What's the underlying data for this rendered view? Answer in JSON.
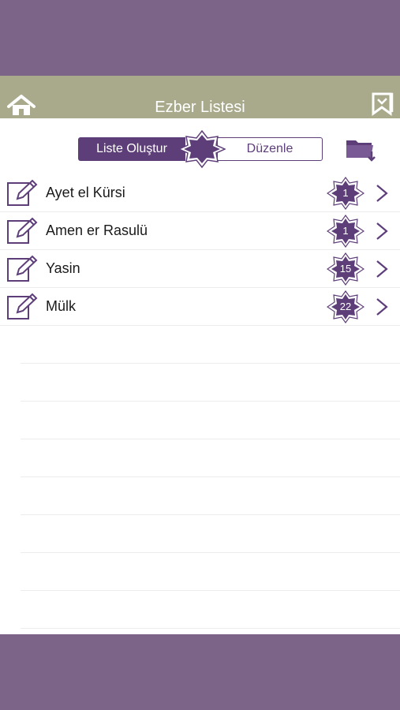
{
  "header": {
    "title": "Ezber Listesi",
    "icons": {
      "home": "home-icon",
      "bookmark": "bookmark-icon"
    }
  },
  "segment": {
    "left_label": "Liste Oluştur",
    "right_label": "Düzenle"
  },
  "toolbar": {
    "folder_icon": "folder-download-icon"
  },
  "list": {
    "items": [
      {
        "label": "Ayet el Kürsi",
        "count": "1"
      },
      {
        "label": "Amen er Rasulü",
        "count": "1"
      },
      {
        "label": "Yasin",
        "count": "15"
      },
      {
        "label": "Mülk",
        "count": "22"
      }
    ]
  },
  "colors": {
    "band": "#7b6488",
    "header": "#a9a98c",
    "accent": "#5e3e79"
  }
}
